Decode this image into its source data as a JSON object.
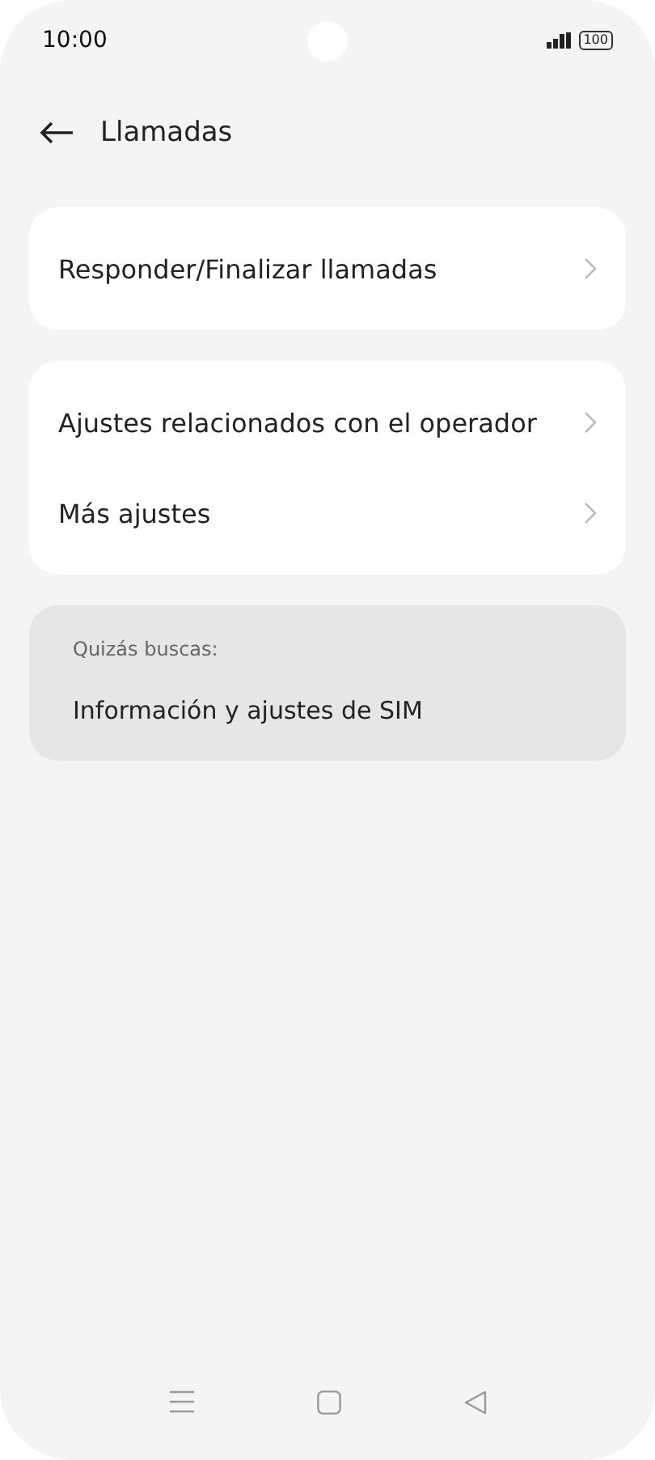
{
  "status_bar": {
    "time": "10:00",
    "battery": "100"
  },
  "header": {
    "title": "Llamadas"
  },
  "groups": [
    {
      "items": [
        {
          "label": "Responder/Finalizar llamadas"
        }
      ]
    },
    {
      "items": [
        {
          "label": "Ajustes relacionados con el operador"
        },
        {
          "label": "Más ajustes"
        }
      ]
    }
  ],
  "suggestions": {
    "heading": "Quizás buscas:",
    "items": [
      {
        "label": "Información y ajustes de SIM"
      }
    ]
  }
}
